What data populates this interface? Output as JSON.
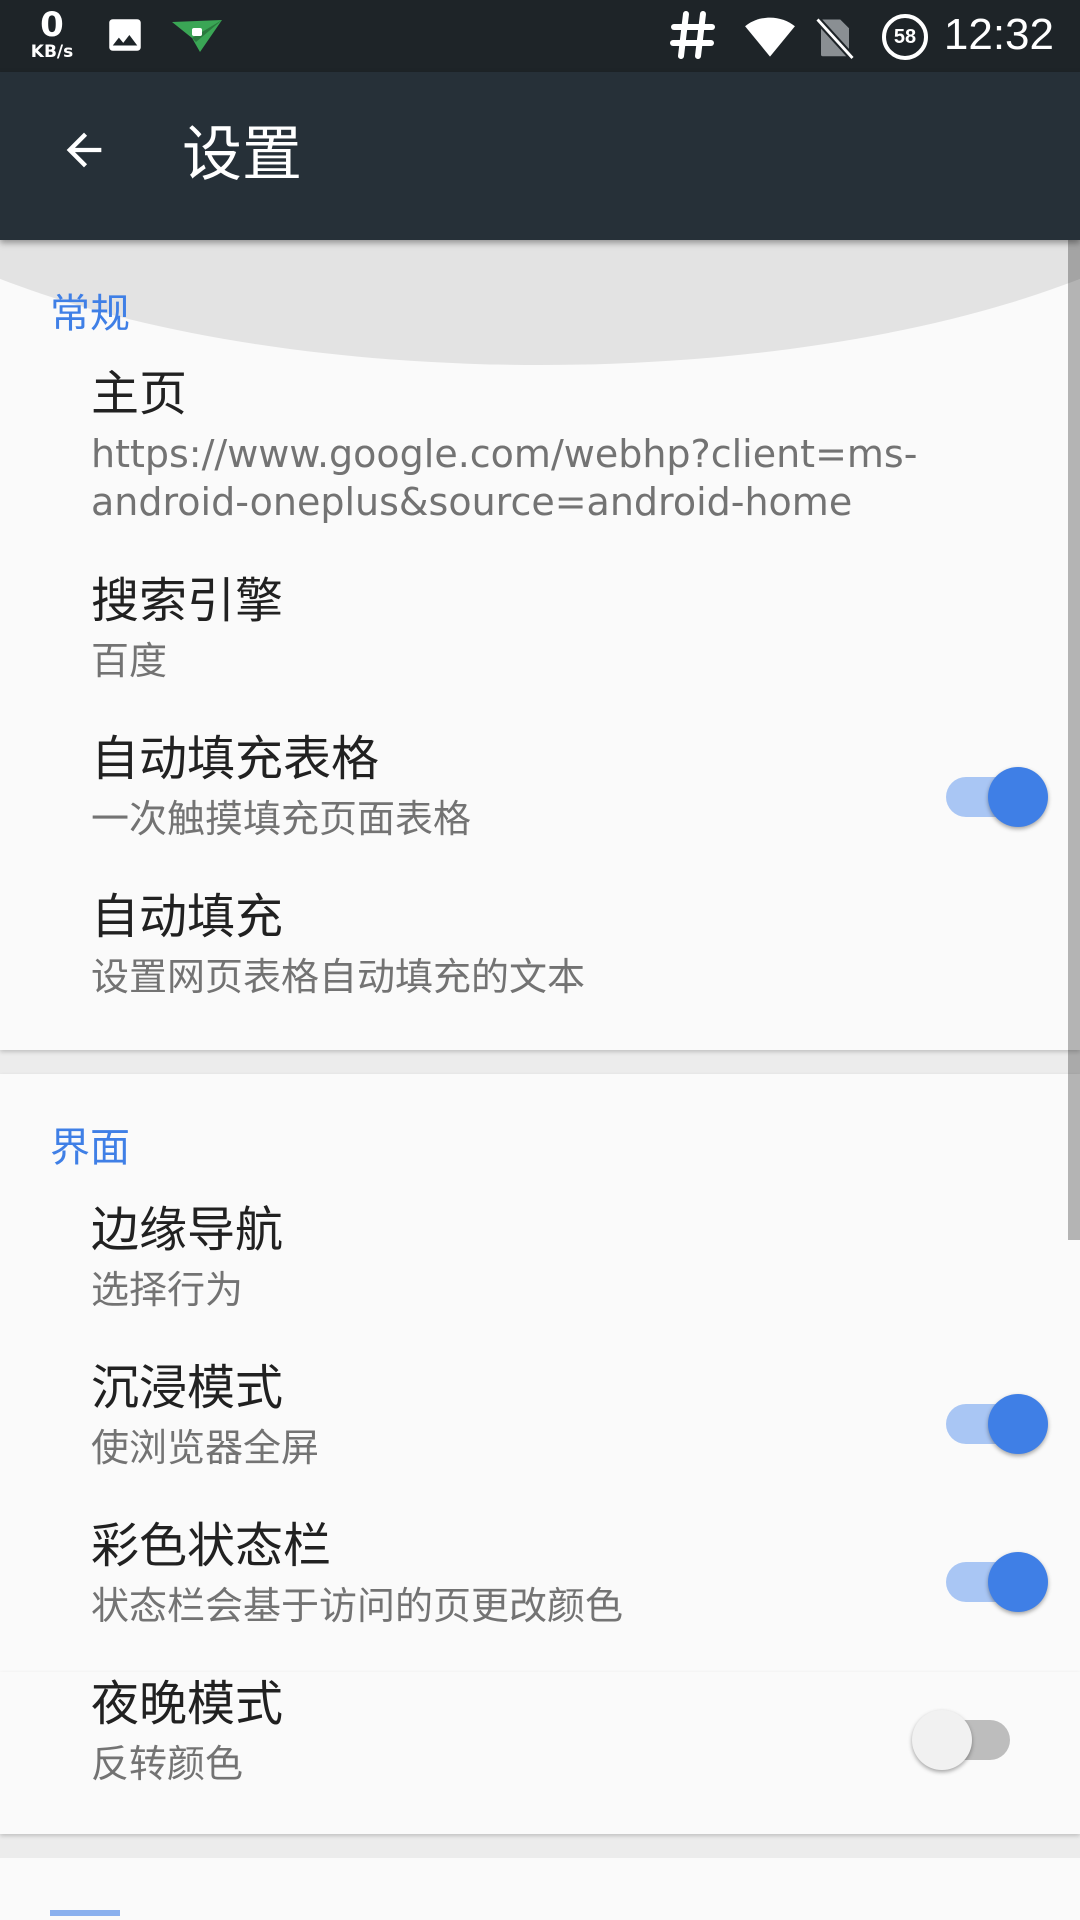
{
  "status_bar": {
    "speed_value": "0",
    "speed_unit": "KB/s",
    "icons": [
      "image-icon",
      "airdroid-icon",
      "hash-icon",
      "wifi-icon",
      "no-sim-icon",
      "battery-icon"
    ],
    "battery_level": "58",
    "time": "12:32"
  },
  "toolbar": {
    "back_icon": "arrow-back-icon",
    "title": "设置",
    "background": "#263038"
  },
  "colors": {
    "accent": "#3f7fe6",
    "switch_track_on": "#a9c6f4",
    "title_text": "#212121",
    "summary_text": "#737373"
  },
  "sections": {
    "general": {
      "header": "常规",
      "items": [
        {
          "title": "主页",
          "summary": "https://www.google.com/webhp?client=ms-android-oneplus&source=android-home"
        },
        {
          "title": "搜索引擎",
          "summary": "百度"
        },
        {
          "title": "自动填充表格",
          "summary": "一次触摸填充页面表格",
          "switch": true
        },
        {
          "title": "自动填充",
          "summary": "设置网页表格自动填充的文本"
        }
      ]
    },
    "interface": {
      "header": "界面",
      "items": [
        {
          "title": "边缘导航",
          "summary": "选择行为"
        },
        {
          "title": "沉浸模式",
          "summary": "使浏览器全屏",
          "switch": true
        },
        {
          "title": "彩色状态栏",
          "summary": "状态栏会基于访问的页更改颜色",
          "switch": true
        },
        {
          "title": "夜晚模式",
          "summary": "反转颜色",
          "switch": false
        }
      ]
    }
  }
}
